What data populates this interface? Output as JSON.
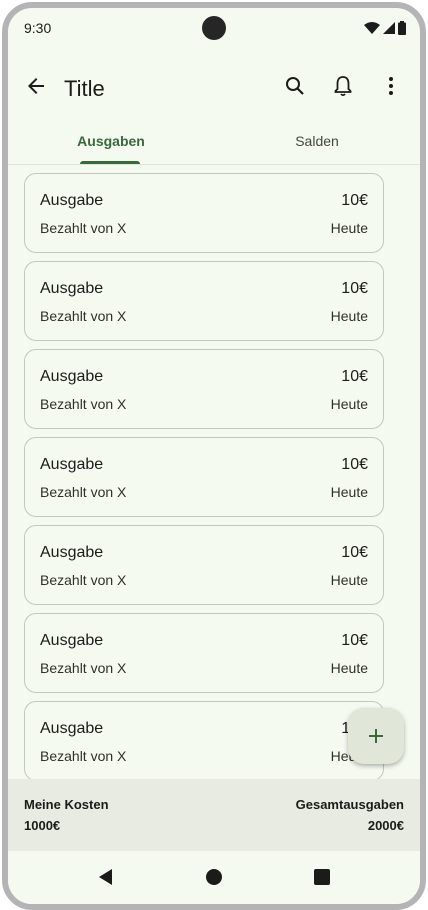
{
  "status_bar": {
    "time": "9:30"
  },
  "app_bar": {
    "title": "Title"
  },
  "tabs": [
    {
      "label": "Ausgaben",
      "active": true
    },
    {
      "label": "Salden",
      "active": false
    }
  ],
  "expenses": [
    {
      "title": "Ausgabe",
      "amount": "10€",
      "paid_by": "Bezahlt von X",
      "date": "Heute"
    },
    {
      "title": "Ausgabe",
      "amount": "10€",
      "paid_by": "Bezahlt von X",
      "date": "Heute"
    },
    {
      "title": "Ausgabe",
      "amount": "10€",
      "paid_by": "Bezahlt von X",
      "date": "Heute"
    },
    {
      "title": "Ausgabe",
      "amount": "10€",
      "paid_by": "Bezahlt von X",
      "date": "Heute"
    },
    {
      "title": "Ausgabe",
      "amount": "10€",
      "paid_by": "Bezahlt von X",
      "date": "Heute"
    },
    {
      "title": "Ausgabe",
      "amount": "10€",
      "paid_by": "Bezahlt von X",
      "date": "Heute"
    },
    {
      "title": "Ausgabe",
      "amount": "10€",
      "paid_by": "Bezahlt von X",
      "date": "Heute"
    }
  ],
  "summary": {
    "my_costs_label": "Meine Kosten",
    "my_costs_value": "1000€",
    "total_label": "Gesamtausgaben",
    "total_value": "2000€"
  },
  "icons": {
    "back": "arrow-back-icon",
    "search": "search-icon",
    "notifications": "bell-icon",
    "more": "more-vert-icon",
    "fab": "plus-icon",
    "nav_back": "triangle-back-icon",
    "nav_home": "circle-home-icon",
    "nav_recents": "square-recents-icon"
  },
  "colors": {
    "accent": "#38693b",
    "background": "#f5faf1",
    "fab_background": "#e0e7d9",
    "summary_background": "#e7ebe2"
  }
}
